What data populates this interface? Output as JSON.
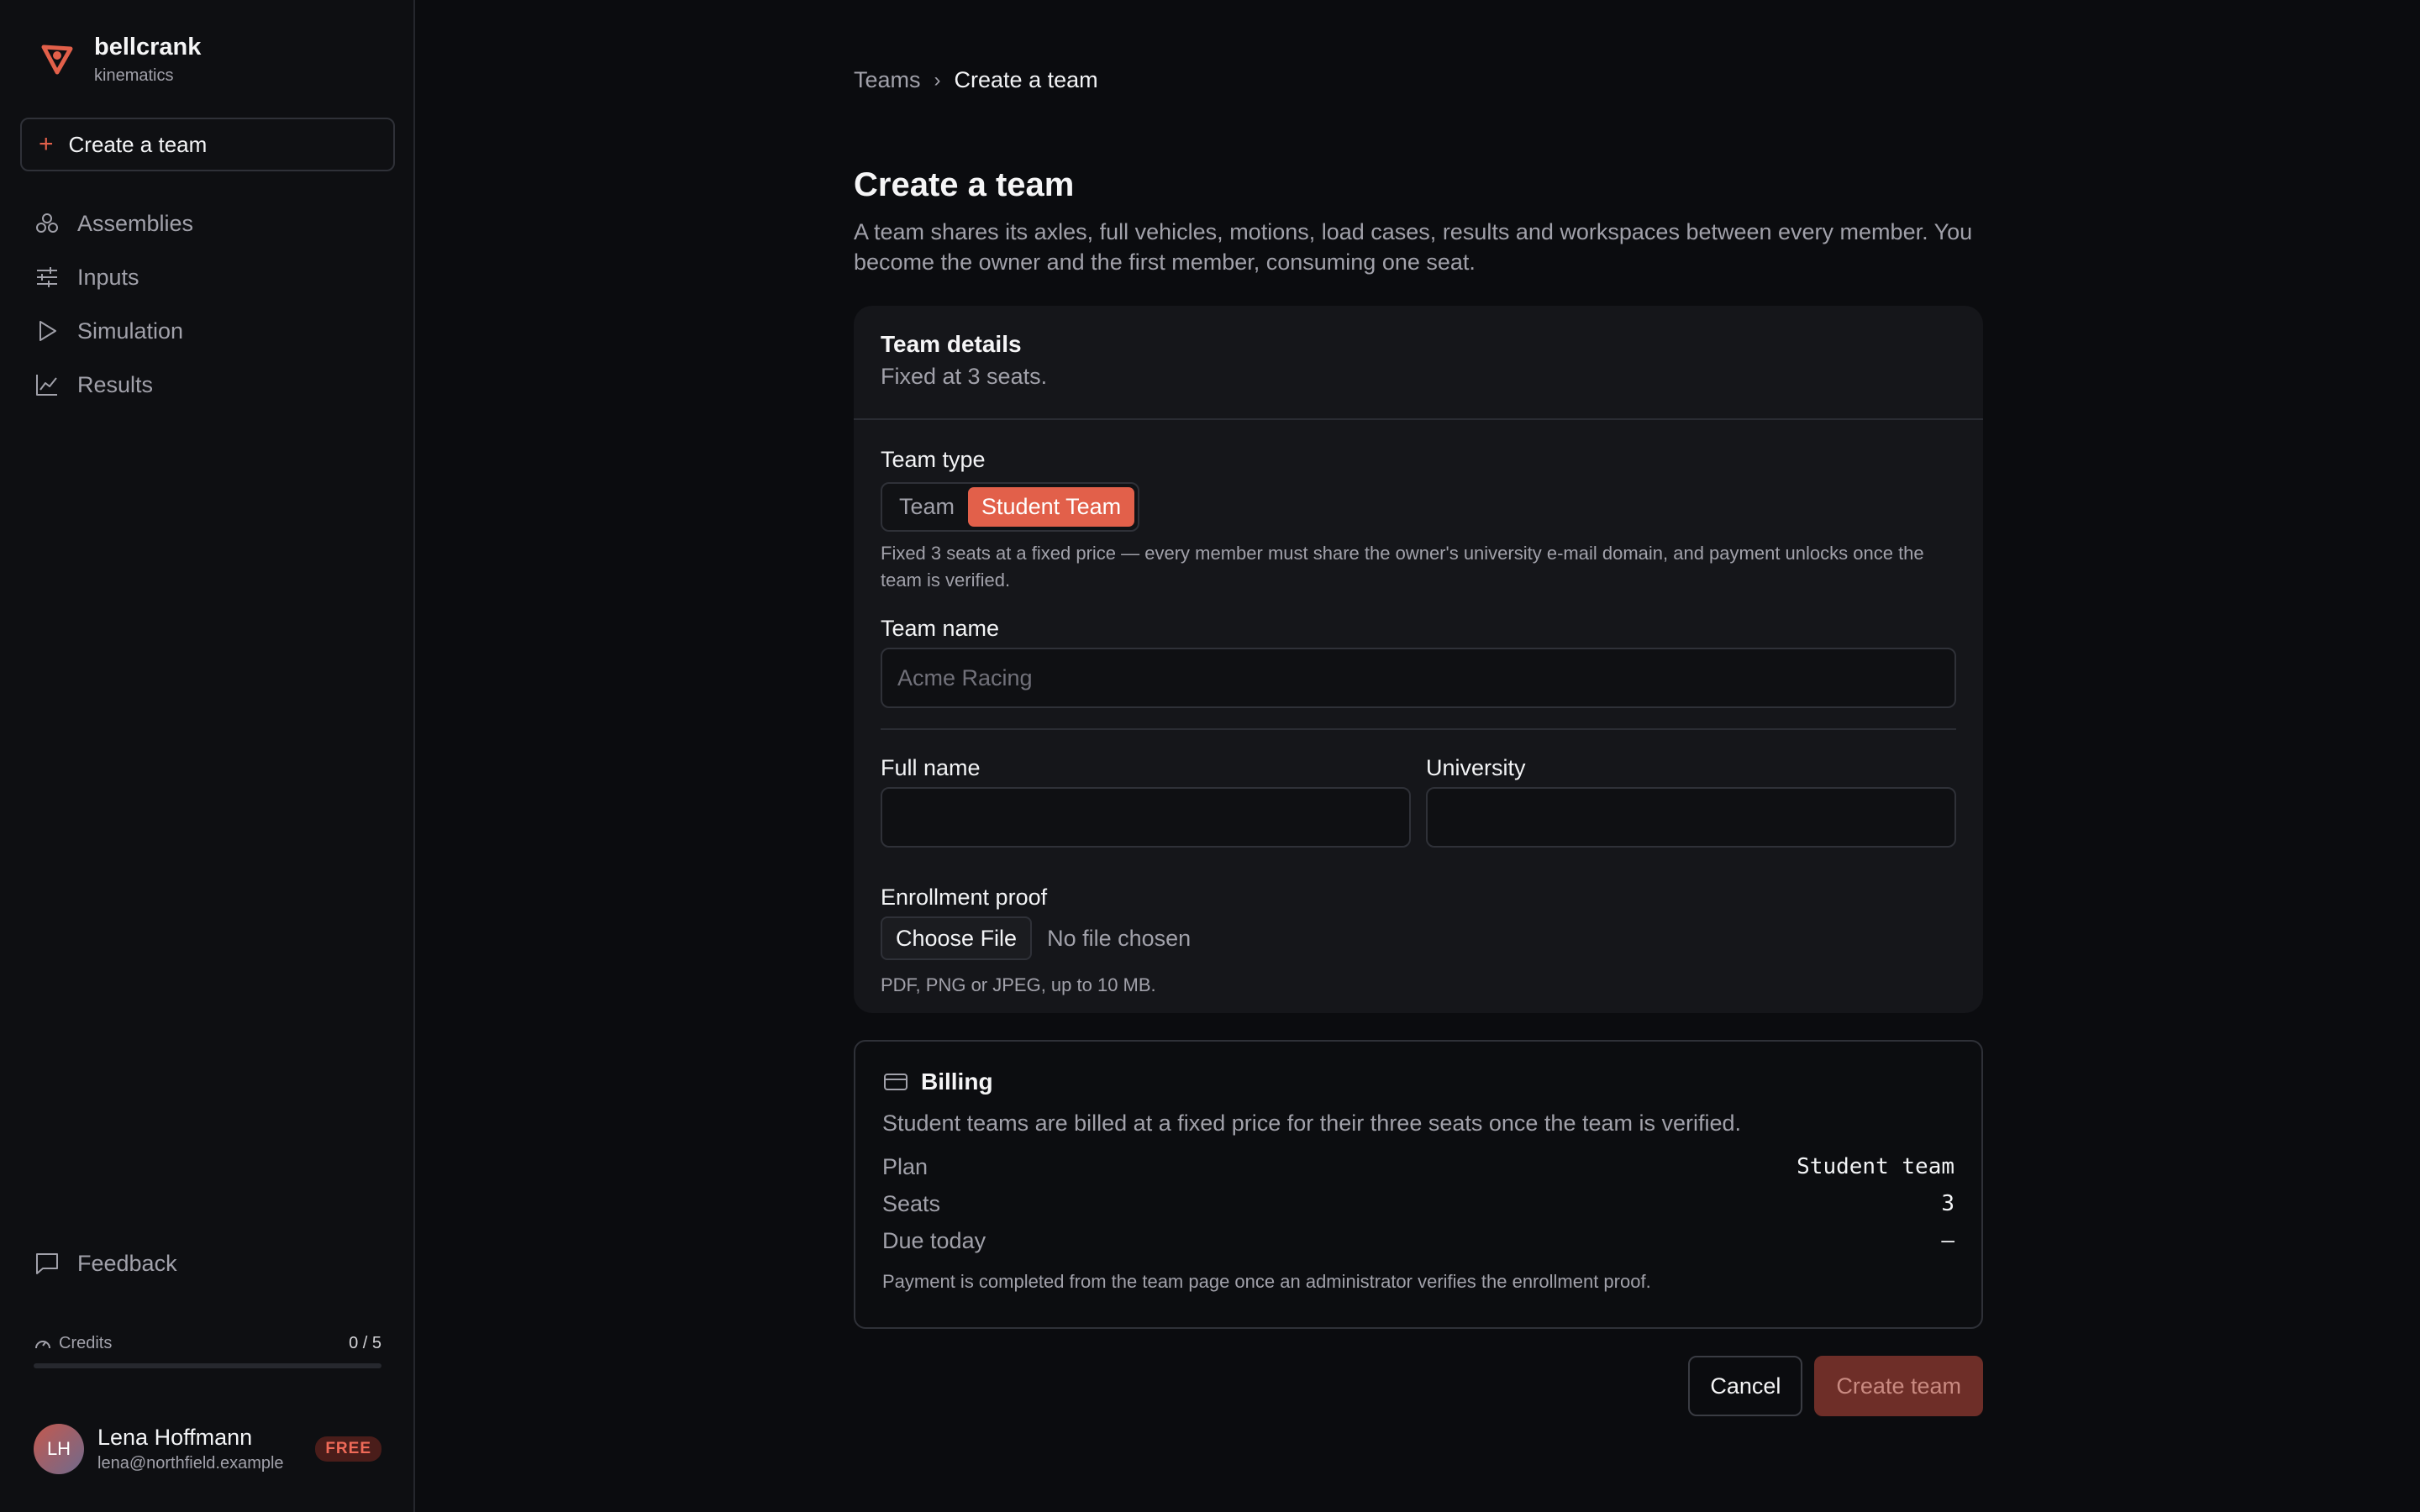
{
  "brand": {
    "name": "bellcrank",
    "sub": "kinematics"
  },
  "sidebar": {
    "create_label": "Create a team",
    "items": [
      {
        "label": "Assemblies",
        "icon": "assemblies-icon"
      },
      {
        "label": "Inputs",
        "icon": "sliders-icon"
      },
      {
        "label": "Simulation",
        "icon": "play-icon"
      },
      {
        "label": "Results",
        "icon": "chart-line-icon"
      }
    ],
    "feedback_label": "Feedback",
    "credits": {
      "label": "Credits",
      "value": "0 / 5",
      "used_fraction": 0
    },
    "user": {
      "initials": "LH",
      "name": "Lena Hoffmann",
      "email": "lena@northfield.example",
      "badge": "FREE"
    }
  },
  "breadcrumb": {
    "parent": "Teams",
    "current": "Create a team"
  },
  "page": {
    "title": "Create a team",
    "description": "A team shares its axles, full vehicles, motions, load cases, results and workspaces between every member. You become the owner and the first member, consuming one seat."
  },
  "team_details": {
    "title": "Team details",
    "subtitle": "Fixed at 3 seats.",
    "type_label": "Team type",
    "type_options": [
      "Team",
      "Student Team"
    ],
    "type_selected": "Student Team",
    "type_hint": "Fixed 3 seats at a fixed price — every member must share the owner's university e-mail domain, and payment unlocks once the team is verified.",
    "name_label": "Team name",
    "name_placeholder": "Acme Racing",
    "fullname_label": "Full name",
    "fullname_value": "",
    "university_label": "University",
    "university_value": "",
    "enroll_label": "Enrollment proof",
    "file_button": "Choose File",
    "file_status": "No file chosen",
    "file_hint": "PDF, PNG or JPEG, up to 10 MB."
  },
  "billing": {
    "title": "Billing",
    "description": "Student teams are billed at a fixed price for their three seats once the team is verified.",
    "rows": [
      {
        "key": "Plan",
        "value": "Student team"
      },
      {
        "key": "Seats",
        "value": "3"
      },
      {
        "key": "Due today",
        "value": "—"
      }
    ],
    "note": "Payment is completed from the team page once an administrator verifies the enrollment proof."
  },
  "actions": {
    "cancel": "Cancel",
    "create": "Create team"
  },
  "colors": {
    "accent": "#e2604a",
    "background": "#0b0c0f",
    "card": "#15161a"
  }
}
